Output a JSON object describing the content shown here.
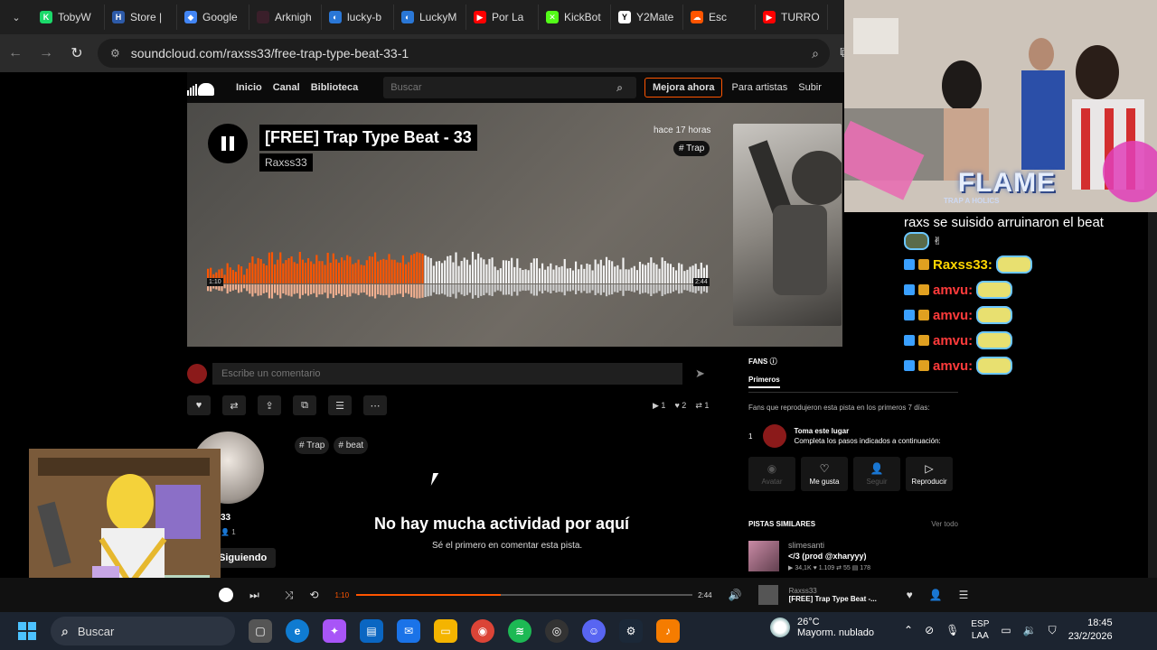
{
  "browser": {
    "tabs": [
      {
        "label": "TobyW",
        "color": "#1bd96a",
        "glyph": "K"
      },
      {
        "label": "Store |",
        "color": "#2d5aa8",
        "glyph": "H"
      },
      {
        "label": "Google",
        "color": "#4285f4",
        "glyph": "◆"
      },
      {
        "label": "Arknigh",
        "color": "#3a1f2a",
        "glyph": ""
      },
      {
        "label": "lucky-b",
        "color": "#2a77d6",
        "glyph": "◐"
      },
      {
        "label": "LuckyM",
        "color": "#2a77d6",
        "glyph": "◐"
      },
      {
        "label": "Por La",
        "color": "#ff0000",
        "glyph": "▶"
      },
      {
        "label": "KickBot",
        "color": "#53fc18",
        "glyph": "✕"
      },
      {
        "label": "Y2Mate",
        "color": "#ffffff",
        "glyph": "Y"
      },
      {
        "label": "Esc",
        "color": "#ff5500",
        "glyph": "☁"
      },
      {
        "label": "TURRO",
        "color": "#ff0000",
        "glyph": "▶"
      }
    ],
    "url": "soundcloud.com/raxss33/free-trap-type-beat-33-1"
  },
  "soundcloud": {
    "nav": {
      "home": "Inicio",
      "feed": "Canal",
      "library": "Biblioteca",
      "search_placeholder": "Buscar",
      "upgrade": "Mejora ahora",
      "artists": "Para artistas",
      "upload": "Subir"
    },
    "track": {
      "title": "[FREE] Trap Type Beat - 33",
      "artist": "Raxss33",
      "posted": "hace 17 horas",
      "tag": "# Trap",
      "elapsed": "1:10",
      "total": "2:44",
      "progress": 0.43
    },
    "comment_placeholder": "Escribe un comentario",
    "stats": {
      "plays": "1",
      "likes": "2",
      "reposts": "1"
    },
    "tags": [
      "# Trap",
      "# beat"
    ],
    "user": {
      "name": "33",
      "followers": "1",
      "follow_label": "Siguiendo"
    },
    "empty": {
      "title": "No hay mucha actividad por aquí",
      "subtitle": "Sé el primero en comentar esta pista."
    },
    "fans": {
      "heading": "FANS",
      "tab": "Primeros",
      "desc": "Fans que reprodujeron esta pista en los primeros 7 días:",
      "rank": "1",
      "slot_title": "Toma este lugar",
      "slot_sub": "Completa los pasos indicados a continuación:",
      "buttons": [
        {
          "label": "Avatar",
          "icon": "avatar-icon",
          "dim": true
        },
        {
          "label": "Me gusta",
          "icon": "heart-icon",
          "dim": false
        },
        {
          "label": "Seguir",
          "icon": "user-icon",
          "dim": true
        },
        {
          "label": "Reproducir",
          "icon": "play-icon",
          "dim": false
        }
      ]
    },
    "similar": {
      "heading": "PISTAS SIMILARES",
      "more": "Ver todo",
      "artist": "slimesanti",
      "title": "</3 (prod @xharyyy)",
      "plays": "34,1K",
      "likes": "1.109",
      "reposts": "55",
      "comments": "178"
    },
    "player": {
      "elapsed": "1:10",
      "total": "2:44",
      "progress": 0.43,
      "artist": "Raxss33",
      "title": "[FREE] Trap Type Beat -..."
    }
  },
  "overlay": {
    "banner": "FLAME",
    "banner_sub": "TRAP A HOLICS",
    "chat_title": "raxs se suisido arruinaron el beat",
    "chat": [
      {
        "user": "Raxss33:",
        "color": "#ffd700"
      },
      {
        "user": "amvu:",
        "color": "#ff3b3b"
      },
      {
        "user": "amvu:",
        "color": "#ff3b3b"
      },
      {
        "user": "amvu:",
        "color": "#ff3b3b"
      },
      {
        "user": "amvu:",
        "color": "#ff3b3b"
      }
    ]
  },
  "taskbar": {
    "search": "Buscar",
    "weather_temp": "26°C",
    "weather_desc": "Mayorm. nublado",
    "weather_badge": "2",
    "lang": "ESP",
    "region": "LAA",
    "time": "18:45",
    "date": "23/2/2026"
  }
}
